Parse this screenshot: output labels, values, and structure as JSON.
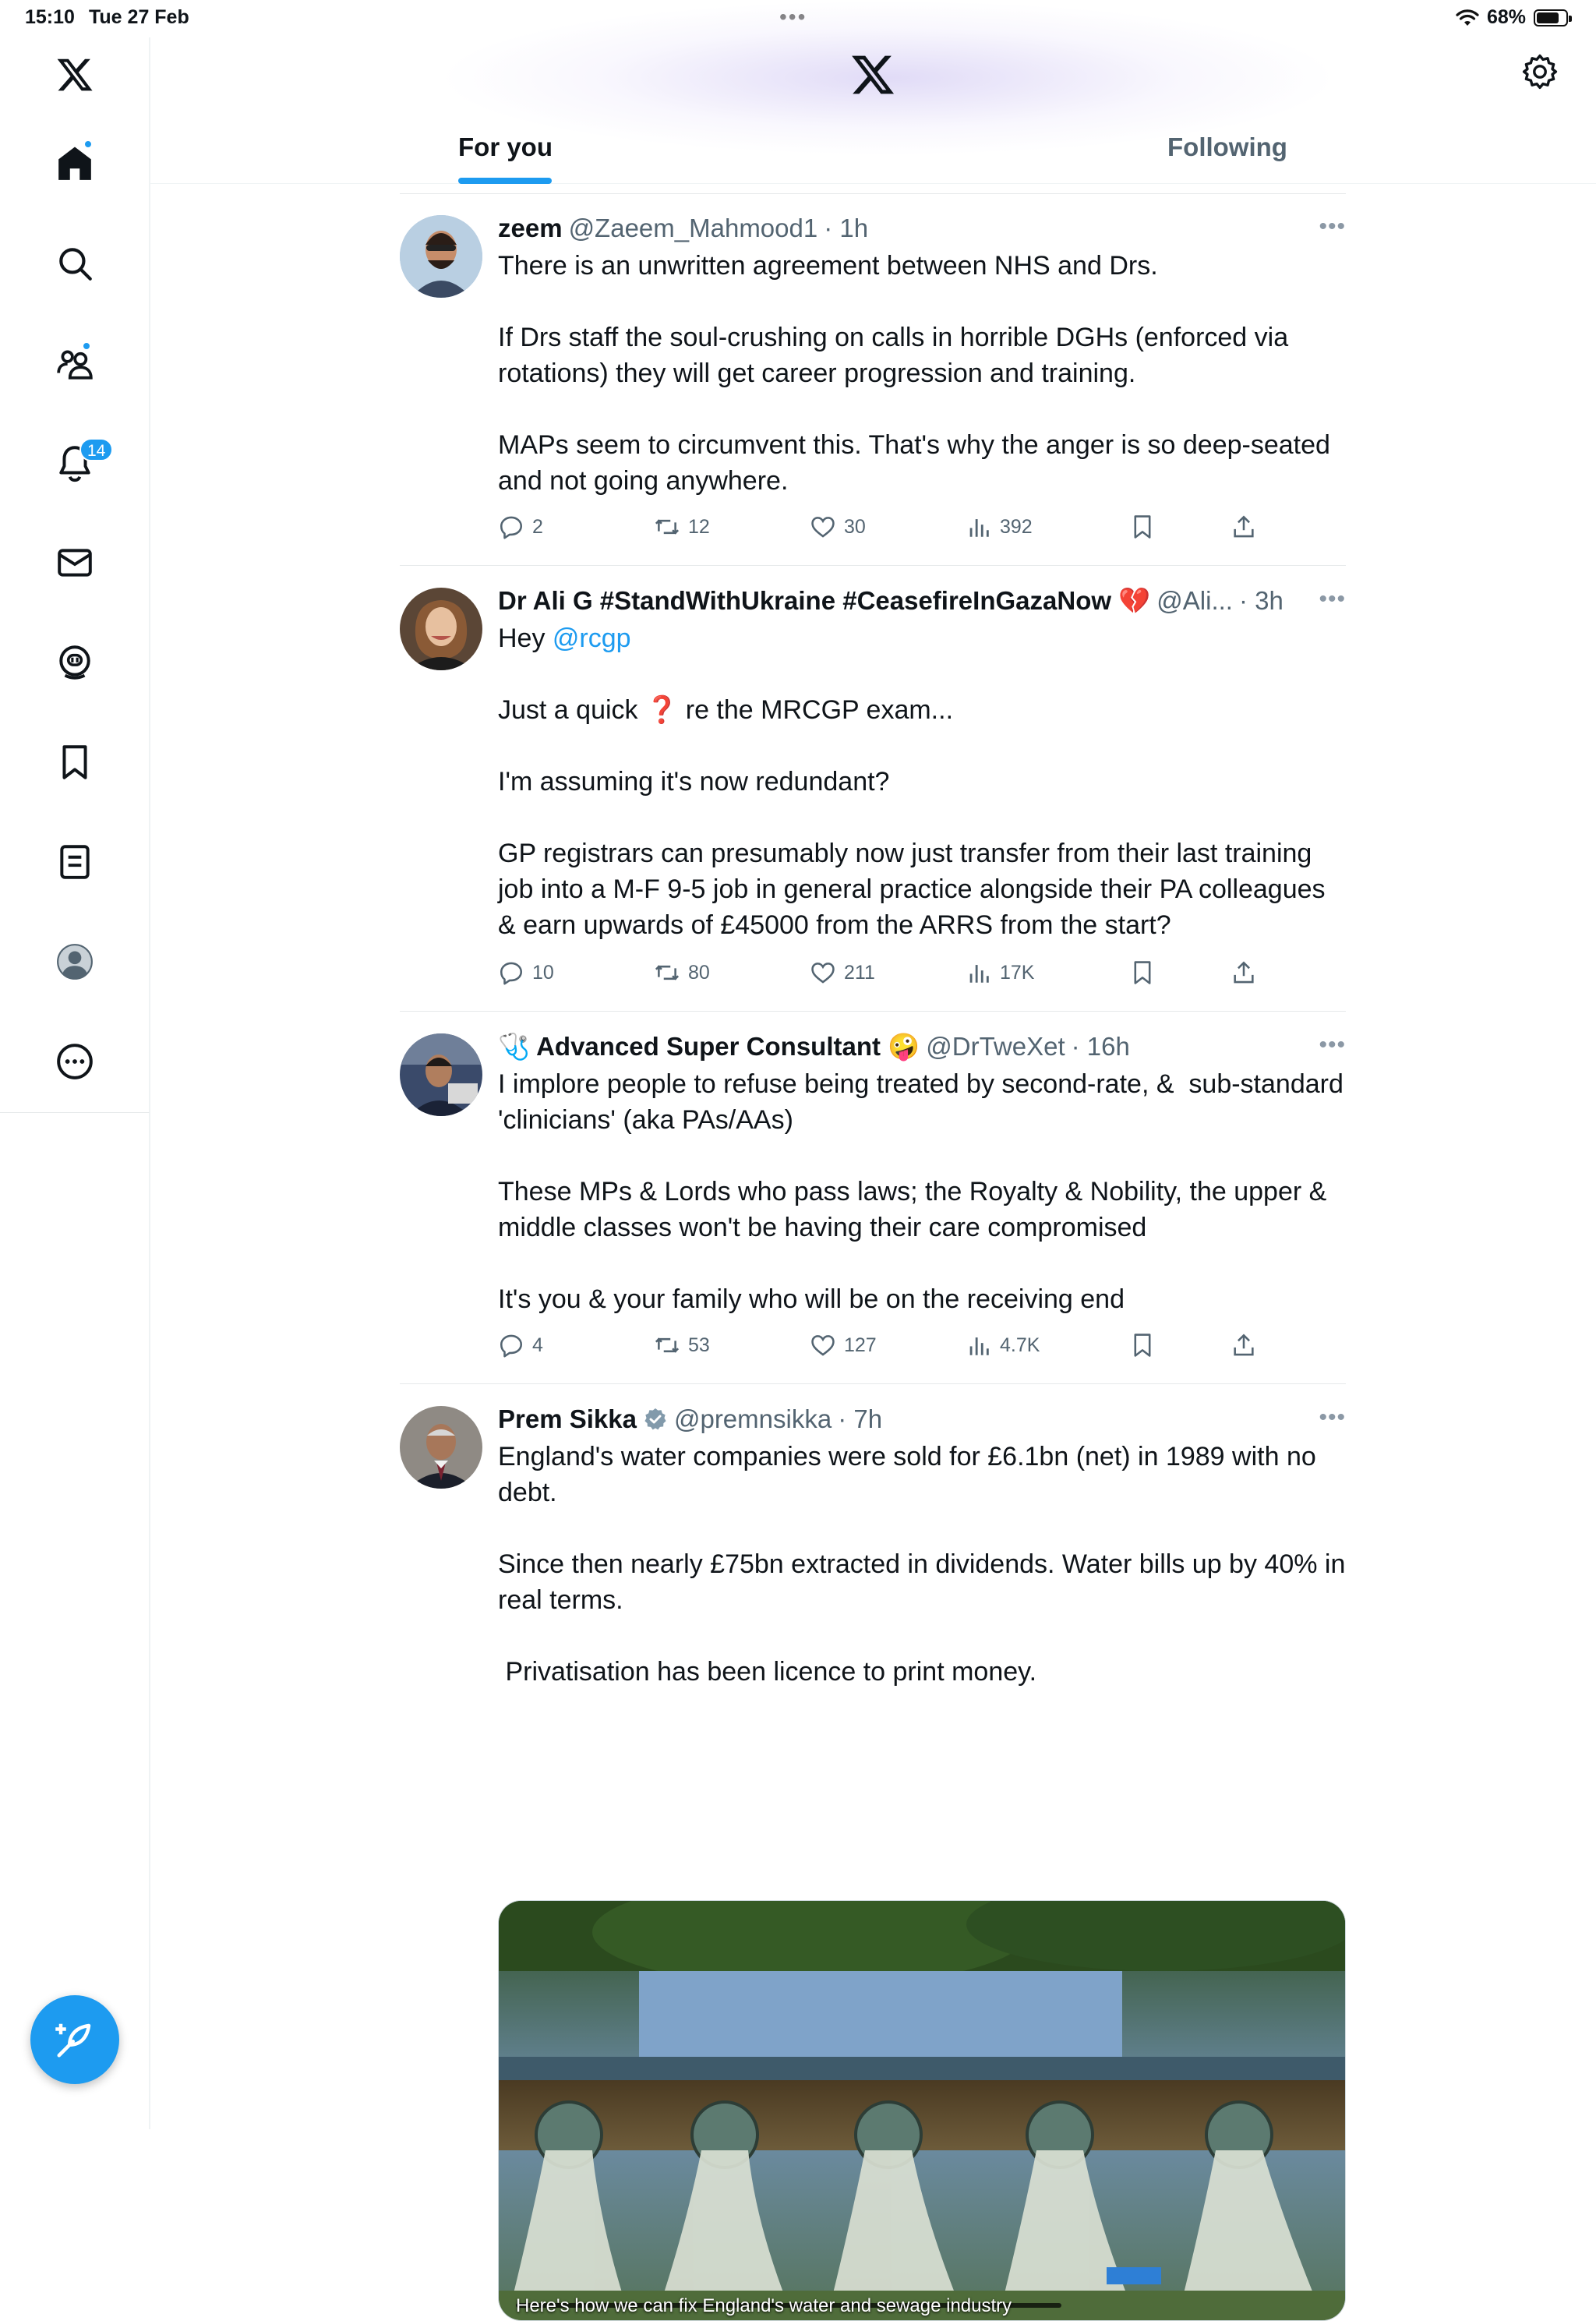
{
  "status_bar": {
    "time": "15:10",
    "date": "Tue 27 Feb",
    "dots": "•••",
    "battery": "68%"
  },
  "sidebar": {
    "items": [
      {
        "icon": "x-logo-icon"
      },
      {
        "icon": "home-icon"
      },
      {
        "icon": "search-icon"
      },
      {
        "icon": "communities-icon"
      },
      {
        "icon": "bell-icon",
        "badge": "14"
      },
      {
        "icon": "mail-icon"
      },
      {
        "icon": "grok-icon"
      },
      {
        "icon": "bookmark-icon"
      },
      {
        "icon": "lists-icon"
      },
      {
        "icon": "profile-icon"
      },
      {
        "icon": "more-icon"
      }
    ],
    "compose_icon": "compose-feather-icon"
  },
  "header": {
    "logo": "x-logo-icon",
    "settings_icon": "gear-icon",
    "tabs": [
      {
        "label": "For you",
        "active": true
      },
      {
        "label": "Following",
        "active": false
      }
    ]
  },
  "colors": {
    "accent": "#1d9bf0",
    "text": "#0f1419",
    "muted": "#536471"
  },
  "tweets": [
    {
      "name": "zeem",
      "handle": "@Zaeem_Mahmood1",
      "time": "· 1h",
      "text": "There is an unwritten agreement between NHS and Drs.\n\nIf Drs staff the soul-crushing on calls in horrible DGHs (enforced via rotations) they will get career progression and training.\n\nMAPs seem to circumvent this. That's why the anger is so deep-seated and not going anywhere.",
      "replies": "2",
      "reposts": "12",
      "likes": "30",
      "views": "392"
    },
    {
      "name": "Dr Ali G #StandWithUkraine #CeasefireInGazaNow 💔",
      "handle": "@Ali...",
      "time": "· 3h",
      "text_pre": "Hey ",
      "mention": "@rcgp",
      "text": "\n\nJust a quick ❓ re the MRCGP exam...\n\nI'm assuming it's now redundant?\n\nGP registrars can presumably now just transfer from their last training job into a M-F 9-5 job in general practice alongside their PA colleagues & earn upwards of £45000 from the ARRS from the start?",
      "replies": "10",
      "reposts": "80",
      "likes": "211",
      "views": "17K"
    },
    {
      "name_prefix": "🩺",
      "name": "Advanced Super Consultant 🤪",
      "handle": "@DrTweXet",
      "time": "· 16h",
      "text": "I implore people to refuse being treated by second-rate, &  sub-standard 'clinicians' (aka PAs/AAs)\n\nThese MPs & Lords who pass laws; the Royalty & Nobility, the upper & middle classes won't be having their care compromised\n\nIt's you & your family who will be on the receiving end",
      "replies": "4",
      "reposts": "53",
      "likes": "127",
      "views": "4.7K"
    },
    {
      "name": "Prem Sikka",
      "verified": true,
      "handle": "@premnsikka",
      "time": "· 7h",
      "text": "England's water companies were sold for £6.1bn (net) in 1989 with no debt.\n\nSince then nearly £75bn extracted in dividends. Water bills up by 40% in real terms.\n\n Privatisation has been licence to print money.",
      "media_caption": "Here's how we can fix England's water and sewage industry"
    }
  ],
  "more_label": "•••"
}
